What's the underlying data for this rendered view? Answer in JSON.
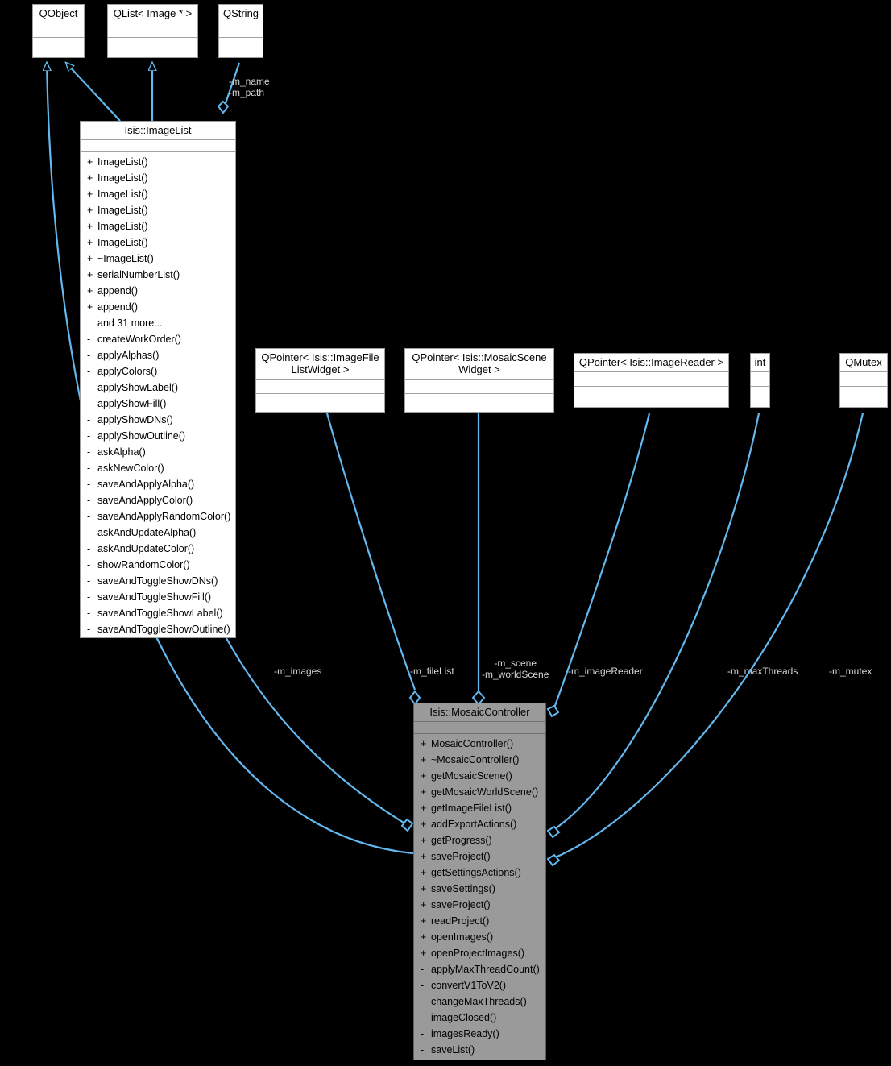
{
  "diagram": {
    "type": "uml-class-diagram",
    "background_color": "#000000",
    "edge_color": "#63b8f0",
    "node_fill": "#ffffff",
    "highlight_node_fill": "#9a9a9a",
    "label_color": "#d6d6d6"
  },
  "nodes": {
    "qobject": {
      "title": "QObject"
    },
    "qlist_image": {
      "title": "QList< Image * >"
    },
    "qstring": {
      "title": "QString"
    },
    "imagelist": {
      "title": "Isis::ImageList"
    },
    "qp_filelist": {
      "title": "QPointer< Isis::ImageFile\nListWidget >"
    },
    "qp_scene": {
      "title": "QPointer< Isis::MosaicScene\nWidget >"
    },
    "qp_reader": {
      "title": "QPointer< Isis::ImageReader >"
    },
    "int": {
      "title": "int"
    },
    "qmutex": {
      "title": "QMutex"
    },
    "mosaic": {
      "title": "Isis::MosaicController"
    }
  },
  "imagelist_operations": [
    {
      "vis": "+",
      "name": "ImageList()"
    },
    {
      "vis": "+",
      "name": "ImageList()"
    },
    {
      "vis": "+",
      "name": "ImageList()"
    },
    {
      "vis": "+",
      "name": "ImageList()"
    },
    {
      "vis": "+",
      "name": "ImageList()"
    },
    {
      "vis": "+",
      "name": "ImageList()"
    },
    {
      "vis": "+",
      "name": "~ImageList()"
    },
    {
      "vis": "+",
      "name": "serialNumberList()"
    },
    {
      "vis": "+",
      "name": "append()"
    },
    {
      "vis": "+",
      "name": "append()"
    },
    {
      "vis": "",
      "name": "and 31 more..."
    },
    {
      "vis": "-",
      "name": "createWorkOrder()"
    },
    {
      "vis": "-",
      "name": "applyAlphas()"
    },
    {
      "vis": "-",
      "name": "applyColors()"
    },
    {
      "vis": "-",
      "name": "applyShowLabel()"
    },
    {
      "vis": "-",
      "name": "applyShowFill()"
    },
    {
      "vis": "-",
      "name": "applyShowDNs()"
    },
    {
      "vis": "-",
      "name": "applyShowOutline()"
    },
    {
      "vis": "-",
      "name": "askAlpha()"
    },
    {
      "vis": "-",
      "name": "askNewColor()"
    },
    {
      "vis": "-",
      "name": "saveAndApplyAlpha()"
    },
    {
      "vis": "-",
      "name": "saveAndApplyColor()"
    },
    {
      "vis": "-",
      "name": "saveAndApplyRandomColor()"
    },
    {
      "vis": "-",
      "name": "askAndUpdateAlpha()"
    },
    {
      "vis": "-",
      "name": "askAndUpdateColor()"
    },
    {
      "vis": "-",
      "name": "showRandomColor()"
    },
    {
      "vis": "-",
      "name": "saveAndToggleShowDNs()"
    },
    {
      "vis": "-",
      "name": "saveAndToggleShowFill()"
    },
    {
      "vis": "-",
      "name": "saveAndToggleShowLabel()"
    },
    {
      "vis": "-",
      "name": "saveAndToggleShowOutline()"
    }
  ],
  "mosaic_operations": [
    {
      "vis": "+",
      "name": "MosaicController()"
    },
    {
      "vis": "+",
      "name": "~MosaicController()"
    },
    {
      "vis": "+",
      "name": "getMosaicScene()"
    },
    {
      "vis": "+",
      "name": "getMosaicWorldScene()"
    },
    {
      "vis": "+",
      "name": "getImageFileList()"
    },
    {
      "vis": "+",
      "name": "addExportActions()"
    },
    {
      "vis": "+",
      "name": "getProgress()"
    },
    {
      "vis": "+",
      "name": "saveProject()"
    },
    {
      "vis": "+",
      "name": "getSettingsActions()"
    },
    {
      "vis": "+",
      "name": "saveSettings()"
    },
    {
      "vis": "+",
      "name": "saveProject()"
    },
    {
      "vis": "+",
      "name": "readProject()"
    },
    {
      "vis": "+",
      "name": "openImages()"
    },
    {
      "vis": "+",
      "name": "openProjectImages()"
    },
    {
      "vis": "-",
      "name": "applyMaxThreadCount()"
    },
    {
      "vis": "-",
      "name": "convertV1ToV2()"
    },
    {
      "vis": "-",
      "name": "changeMaxThreads()"
    },
    {
      "vis": "-",
      "name": "imageClosed()"
    },
    {
      "vis": "-",
      "name": "imagesReady()"
    },
    {
      "vis": "-",
      "name": "saveList()"
    }
  ],
  "edge_labels": {
    "name_path": "-m_name\n-m_path",
    "images": "-m_images",
    "filelist": "-m_fileList",
    "scenes": "-m_scene\n-m_worldScene",
    "imagereader": "-m_imageReader",
    "maxthreads": "-m_maxThreads",
    "mutex": "-m_mutex"
  }
}
